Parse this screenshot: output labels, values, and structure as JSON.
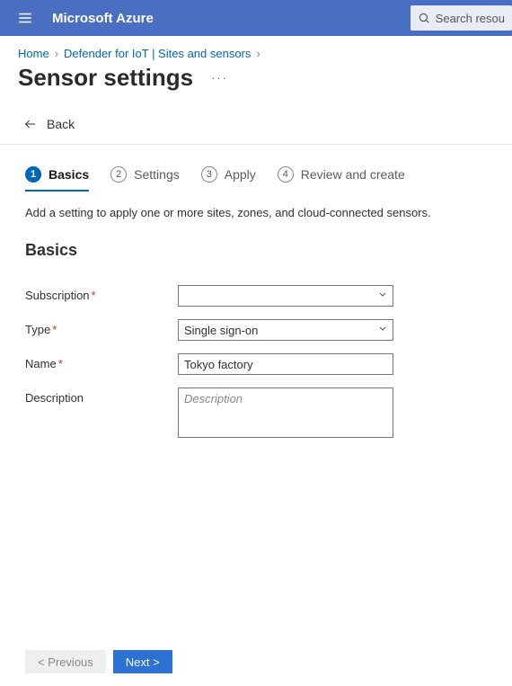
{
  "header": {
    "brand": "Microsoft Azure",
    "search_placeholder": "Search resou"
  },
  "breadcrumb": {
    "home": "Home",
    "product": "Defender for IoT | Sites and sensors"
  },
  "page": {
    "title": "Sensor settings",
    "back_label": "Back",
    "hint": "Add a setting to apply one or more sites, zones, and cloud-connected sensors.",
    "section_title": "Basics"
  },
  "steps": [
    {
      "num": "1",
      "label": "Basics"
    },
    {
      "num": "2",
      "label": "Settings"
    },
    {
      "num": "3",
      "label": "Apply"
    },
    {
      "num": "4",
      "label": "Review and create"
    }
  ],
  "form": {
    "subscription": {
      "label": "Subscription",
      "value": ""
    },
    "type": {
      "label": "Type",
      "value": "Single sign-on"
    },
    "name": {
      "label": "Name",
      "value": "Tokyo factory"
    },
    "description": {
      "label": "Description",
      "placeholder": "Description",
      "value": ""
    }
  },
  "footer": {
    "prev": "< Previous",
    "next": "Next >"
  }
}
